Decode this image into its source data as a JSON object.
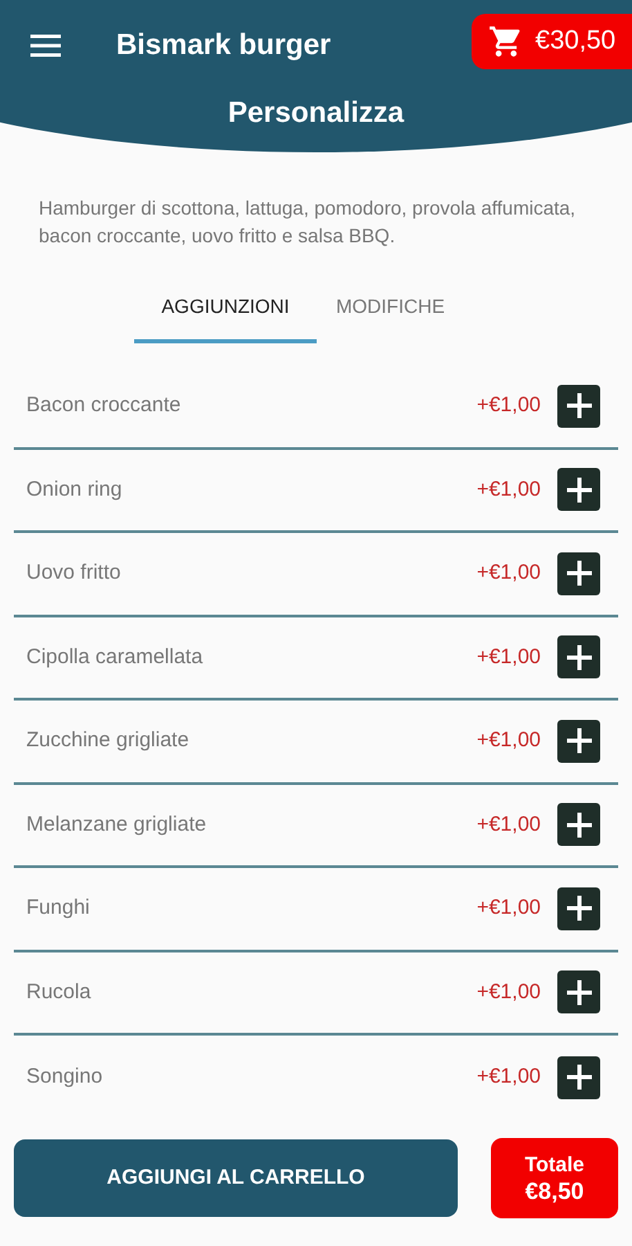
{
  "header": {
    "title": "Bismark burger",
    "cart_total": "€30,50",
    "subtitle": "Personalizza"
  },
  "description": "Hamburger di scottona, lattuga, pomodoro, provola affumicata, bacon croccante, uovo fritto e salsa BBQ.",
  "tabs": [
    {
      "label": "AGGIUNZIONI",
      "selected": true
    },
    {
      "label": "MODIFICHE",
      "selected": false
    }
  ],
  "items": [
    {
      "name": "Bacon croccante",
      "price": "+€1,00"
    },
    {
      "name": "Onion ring",
      "price": "+€1,00"
    },
    {
      "name": "Uovo fritto",
      "price": "+€1,00"
    },
    {
      "name": "Cipolla caramellata",
      "price": "+€1,00"
    },
    {
      "name": "Zucchine grigliate",
      "price": "+€1,00"
    },
    {
      "name": "Melanzane grigliate",
      "price": "+€1,00"
    },
    {
      "name": "Funghi",
      "price": "+€1,00"
    },
    {
      "name": "Rucola",
      "price": "+€1,00"
    },
    {
      "name": "Songino",
      "price": "+€1,00"
    }
  ],
  "footer": {
    "button": "AGGIUNGI AL CARRELLO",
    "total_label": "Totale",
    "total": "€8,50"
  }
}
